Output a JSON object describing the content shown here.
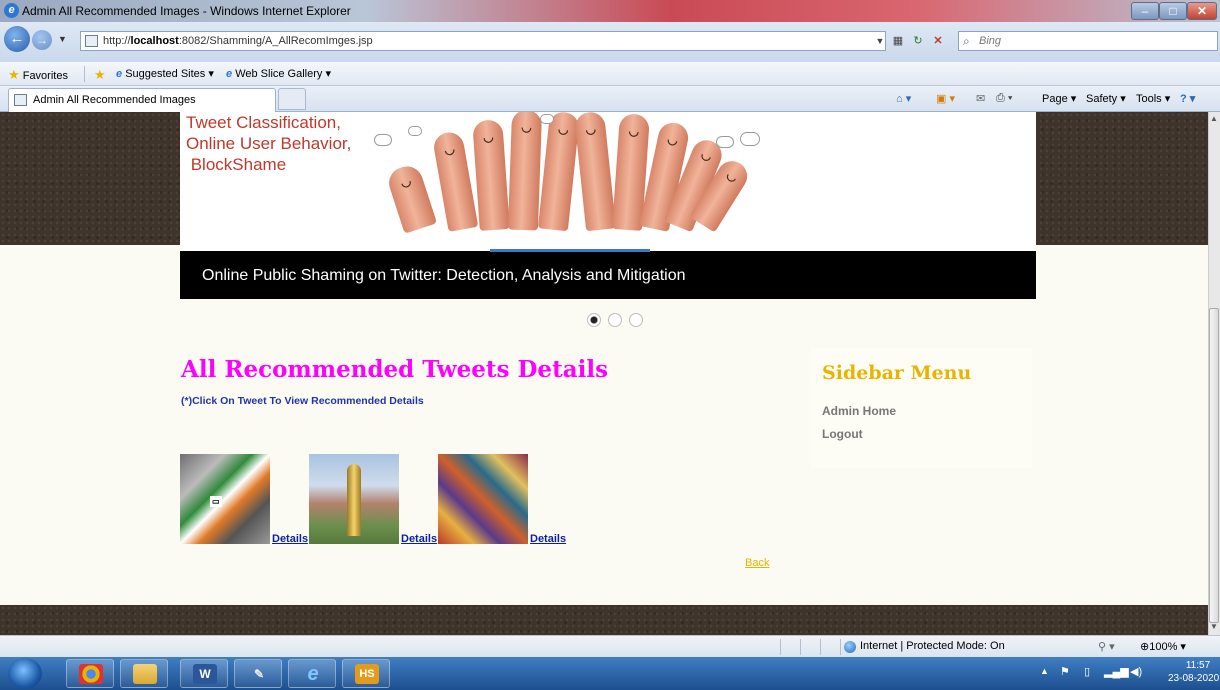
{
  "window": {
    "title": "Admin All Recommended Images - Windows Internet Explorer"
  },
  "address": {
    "url_prefix": "http://",
    "url_host": "localhost",
    "url_rest": ":8082/Shamming/A_AllRecomImges.jsp",
    "search_placeholder": "Bing"
  },
  "favorites": {
    "favorites_label": "Favorites",
    "suggested_sites": "Suggested Sites ▾",
    "web_slice_gallery": "Web Slice Gallery ▾"
  },
  "tabs": [
    {
      "label": "Admin All Recommended Images"
    }
  ],
  "commands": {
    "page": "Page ▾",
    "safety": "Safety ▾",
    "tools": "Tools ▾"
  },
  "page": {
    "banner_lines": [
      "Tweet Classification,",
      "Online User Behavior,",
      " BlockShame"
    ],
    "caption": "Online Public Shaming on Twitter: Detection, Analysis and Mitigation",
    "heading": "All Recommended Tweets Details",
    "note": "(*)Click On Tweet To View Recommended Details",
    "items": [
      {
        "link": "Details",
        "image": "politics-of-india-collage"
      },
      {
        "link": "Details",
        "image": "cricket-world-cup-trophy"
      },
      {
        "link": "Details",
        "image": "bollywood-posters-collage"
      }
    ],
    "back_link": "Back",
    "sidebar": {
      "title": "Sidebar Menu",
      "links": [
        "Admin Home",
        "Logout"
      ]
    }
  },
  "status": {
    "zone": "Internet | Protected Mode: On",
    "zoom": "100%"
  },
  "taskbar": {
    "time": "11:57",
    "date": "23-08-2020"
  },
  "colors": {
    "heading": "#ff00ff",
    "sidebar_title": "#e8b400",
    "banner_text": "#c0392b",
    "link": "#0a1fa5"
  }
}
